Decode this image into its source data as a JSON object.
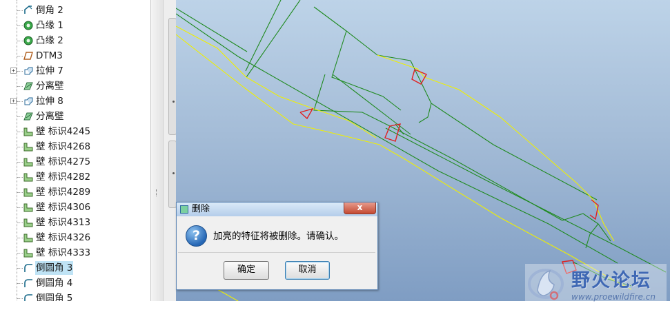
{
  "tree": {
    "items": [
      {
        "label": "倒角 2",
        "icon": "chamfer-icon",
        "expander": false,
        "selected": false
      },
      {
        "label": "凸缘 1",
        "icon": "flange-icon",
        "expander": false,
        "selected": false
      },
      {
        "label": "凸缘 2",
        "icon": "flange-icon",
        "expander": false,
        "selected": false
      },
      {
        "label": "DTM3",
        "icon": "datum-plane-icon",
        "expander": false,
        "selected": false
      },
      {
        "label": "拉伸 7",
        "icon": "extrude-icon",
        "expander": true,
        "selected": false
      },
      {
        "label": "分离壁",
        "icon": "separate-wall-icon",
        "expander": false,
        "selected": false
      },
      {
        "label": "拉伸 8",
        "icon": "extrude-icon",
        "expander": true,
        "selected": false
      },
      {
        "label": "分离壁",
        "icon": "separate-wall-icon",
        "expander": false,
        "selected": false
      },
      {
        "label": "壁 标识4245",
        "icon": "wall-icon",
        "expander": false,
        "selected": false
      },
      {
        "label": "壁 标识4268",
        "icon": "wall-icon",
        "expander": false,
        "selected": false
      },
      {
        "label": "壁 标识4275",
        "icon": "wall-icon",
        "expander": false,
        "selected": false
      },
      {
        "label": "壁 标识4282",
        "icon": "wall-icon",
        "expander": false,
        "selected": false
      },
      {
        "label": "壁 标识4289",
        "icon": "wall-icon",
        "expander": false,
        "selected": false
      },
      {
        "label": "壁 标识4306",
        "icon": "wall-icon",
        "expander": false,
        "selected": false
      },
      {
        "label": "壁 标识4313",
        "icon": "wall-icon",
        "expander": false,
        "selected": false
      },
      {
        "label": "壁 标识4326",
        "icon": "wall-icon",
        "expander": false,
        "selected": false
      },
      {
        "label": "壁 标识4333",
        "icon": "wall-icon",
        "expander": false,
        "selected": false
      },
      {
        "label": "倒圆角 3",
        "icon": "round-icon",
        "expander": false,
        "selected": true
      },
      {
        "label": "倒圆角 4",
        "icon": "round-icon",
        "expander": false,
        "selected": false
      },
      {
        "label": "倒圆角 5",
        "icon": "round-icon",
        "expander": false,
        "selected": false
      }
    ]
  },
  "dialog": {
    "title": "删除",
    "close_label": "x",
    "message": "加亮的特征将被删除。请确认。",
    "ok_label": "确定",
    "cancel_label": "取消"
  },
  "watermark": {
    "text": "野火论坛",
    "url": "www.proewildfire.cn"
  },
  "colors": {
    "viewport_top": "#bdd3e8",
    "viewport_bottom": "#7f9dc3",
    "edge_green": "#1f8a1f",
    "edge_yellow": "#f0f000",
    "highlight_red": "#e02020",
    "selection": "#bfe3f5"
  }
}
